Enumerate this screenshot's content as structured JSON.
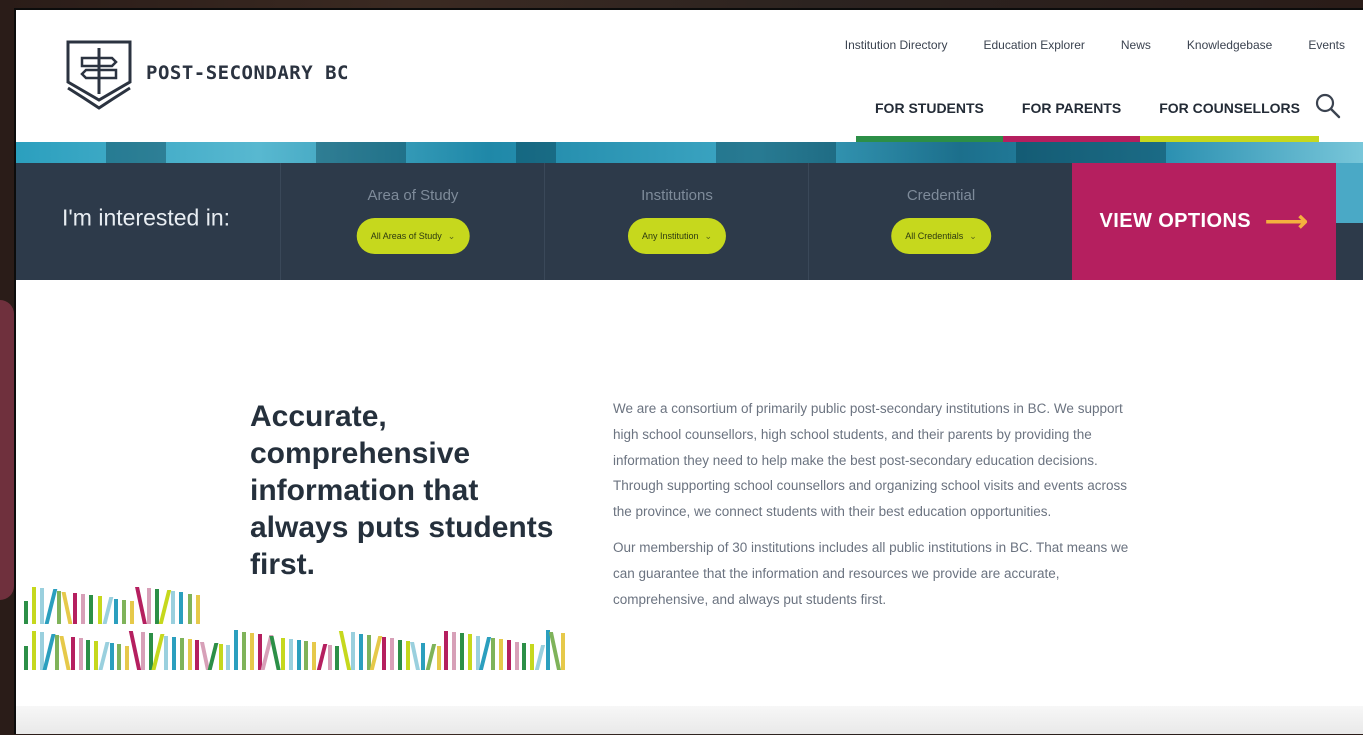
{
  "brand": {
    "name": "POST-SECONDARY BC"
  },
  "utility_nav": [
    "Institution Directory",
    "Education Explorer",
    "News",
    "Knowledgebase",
    "Events"
  ],
  "main_nav": [
    {
      "label": "FOR STUDENTS",
      "color": "#2c8f47"
    },
    {
      "label": "FOR PARENTS",
      "color": "#b51f5f"
    },
    {
      "label": "FOR COUNSELLORS",
      "color": "#c6d81d"
    }
  ],
  "search": {
    "icon": "search-icon"
  },
  "finder": {
    "lead": "I'm interested in:",
    "filters": [
      {
        "label": "Area of Study",
        "value": "All Areas of Study"
      },
      {
        "label": "Institutions",
        "value": "Any Institution"
      },
      {
        "label": "Credential",
        "value": "All Credentials"
      }
    ],
    "cta": "VIEW OPTIONS"
  },
  "content": {
    "headline": "Accurate, comprehensive information that always puts students first.",
    "paragraphs": [
      "We are a consortium of primarily public post-secondary institutions in BC. We support high school counsellors, high school students, and their parents by providing the information they need to help make the best post-secondary education decisions. Through supporting school counsellors and organizing school visits and events across the province, we connect students with their best education opportunities.",
      "Our membership of 30 institutions includes all public institutions in BC. That means we can guarantee that the information and resources we provide are accurate, comprehensive, and always put students first."
    ]
  },
  "colors": {
    "navy": "#2d3a4a",
    "magenta": "#b51f5f",
    "lime": "#c6d81d",
    "green": "#2c8f47",
    "teal": "#2b9fbe"
  }
}
